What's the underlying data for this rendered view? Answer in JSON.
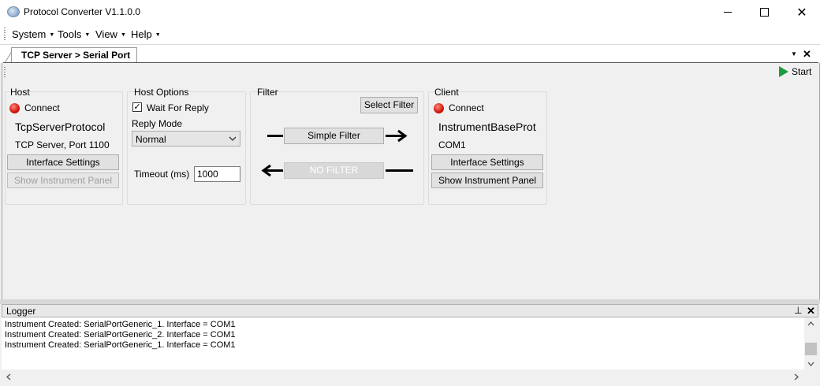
{
  "window": {
    "title": "Protocol Converter V1.1.0.0",
    "minimize": "—",
    "maximize": "☐",
    "close": "✕"
  },
  "menu": [
    {
      "label": "System"
    },
    {
      "label": "Tools"
    },
    {
      "label": "View"
    },
    {
      "label": "Help"
    }
  ],
  "document": {
    "tab_label": "TCP Server > Serial Port",
    "start_label": "Start"
  },
  "host": {
    "title": "Host",
    "connect_label": "Connect",
    "protocol": "TcpServerProtocol",
    "description": "TCP Server, Port 1100",
    "interface_settings": "Interface Settings",
    "show_instrument_panel": "Show Instrument Panel"
  },
  "host_options": {
    "title": "Host Options",
    "wait_for_reply": "Wait For Reply",
    "wait_for_reply_checked": true,
    "reply_mode_label": "Reply Mode",
    "reply_mode_value": "Normal",
    "timeout_label": "Timeout (ms)",
    "timeout_value": "1000"
  },
  "filter": {
    "title": "Filter",
    "select_filter": "Select Filter",
    "simple_filter": "Simple Filter",
    "no_filter": "NO FILTER"
  },
  "client": {
    "title": "Client",
    "connect_label": "Connect",
    "protocol": "InstrumentBaseProt",
    "port": "COM1",
    "interface_settings": "Interface Settings",
    "show_instrument_panel": "Show Instrument Panel"
  },
  "logger": {
    "title": "Logger",
    "lines": [
      "Instrument Created: SerialPortGeneric_1. Interface = COM1",
      "Instrument Created: SerialPortGeneric_2. Interface = COM1",
      "Instrument Created: SerialPortGeneric_1. Interface = COM1"
    ]
  },
  "colors": {
    "led_red": "#d81c10",
    "start_green": "#1f9a3a"
  }
}
